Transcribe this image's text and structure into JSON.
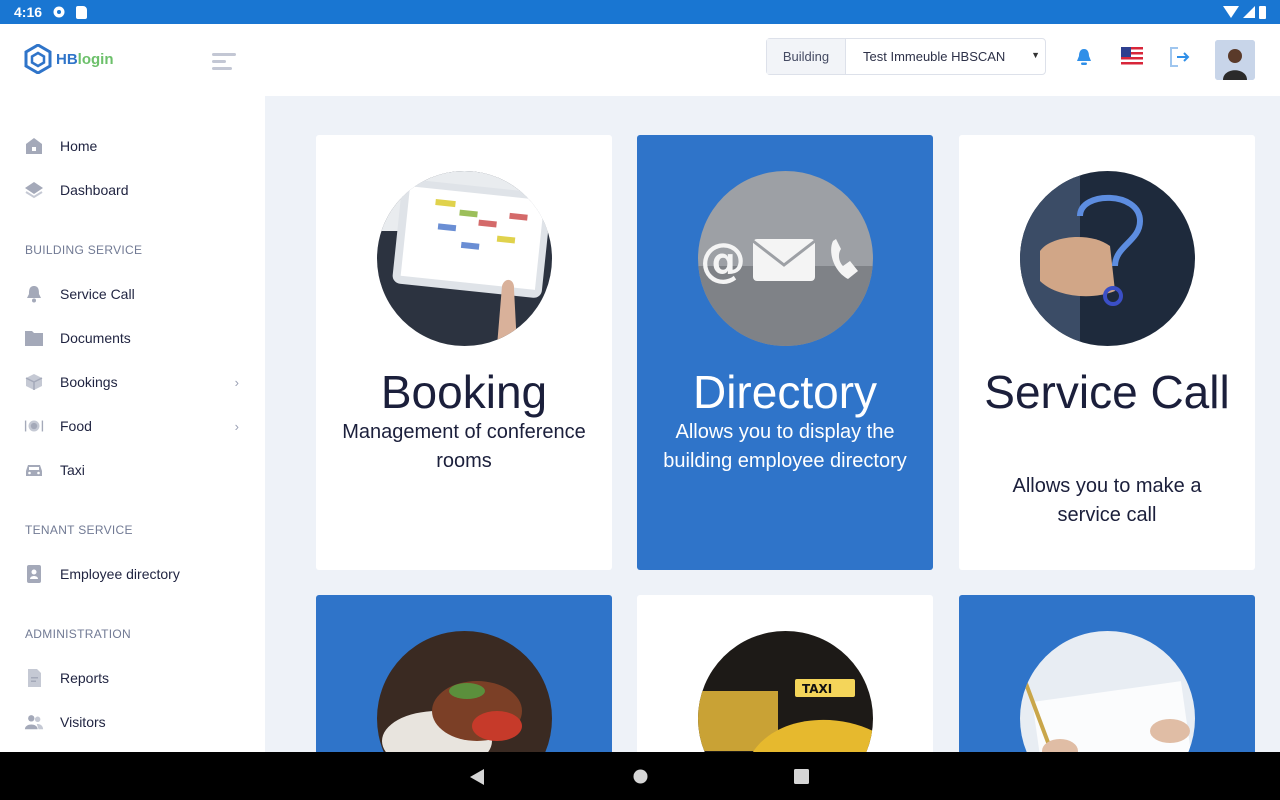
{
  "statusbar": {
    "time": "4:16"
  },
  "brand": {
    "hb": "HB",
    "login": "login"
  },
  "sidebar": {
    "items": [
      {
        "label": "Home",
        "icon": "home-icon"
      },
      {
        "label": "Dashboard",
        "icon": "layers-icon"
      }
    ],
    "sections": [
      {
        "title": "BUILDING SERVICE"
      },
      {
        "title": "TENANT SERVICE"
      },
      {
        "title": "ADMINISTRATION"
      }
    ],
    "building_items": [
      {
        "label": "Service Call",
        "icon": "bell-icon"
      },
      {
        "label": "Documents",
        "icon": "folder-icon"
      },
      {
        "label": "Bookings",
        "icon": "box-icon",
        "has_submenu": true
      },
      {
        "label": "Food",
        "icon": "plate-icon",
        "has_submenu": true
      },
      {
        "label": "Taxi",
        "icon": "car-icon"
      }
    ],
    "tenant_items": [
      {
        "label": "Employee directory",
        "icon": "contact-icon"
      }
    ],
    "admin_items": [
      {
        "label": "Reports",
        "icon": "document-icon"
      },
      {
        "label": "Visitors",
        "icon": "users-icon"
      }
    ]
  },
  "header": {
    "building_label": "Building",
    "building_value": "Test Immeuble HBSCAN"
  },
  "cards": [
    {
      "title": "Booking",
      "desc": "Management of conference rooms",
      "theme": "white"
    },
    {
      "title": "Directory",
      "desc": "Allows you to display the building employee directory",
      "theme": "blue"
    },
    {
      "title": "Service Call",
      "desc": "Allows you to make a service call",
      "theme": "white"
    }
  ],
  "colors": {
    "accent": "#2f74c9",
    "statusbar": "#1976d2",
    "background": "#eef2f8"
  }
}
